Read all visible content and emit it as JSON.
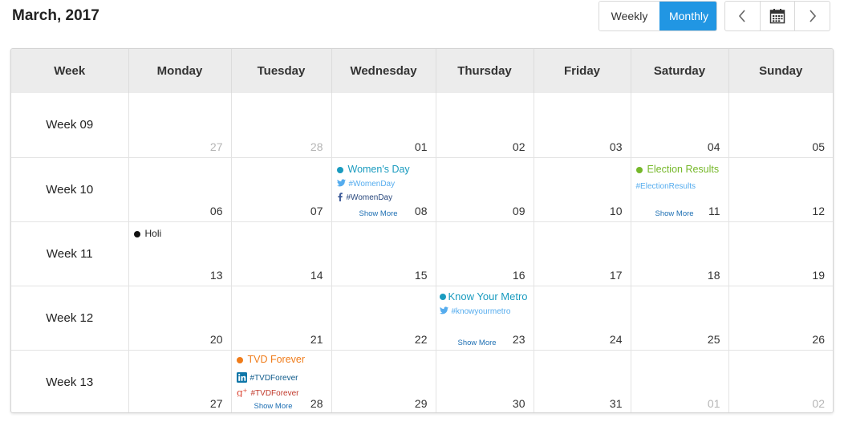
{
  "header": {
    "title": "March, 2017",
    "view_weekly": "Weekly",
    "view_monthly": "Monthly"
  },
  "colors": {
    "accent": "#2196e3",
    "teal": "#1a9bbf",
    "green": "#76b82a",
    "orange": "#f07c1a",
    "twitter": "#55acee",
    "facebook": "#3b5998",
    "linkedin": "#0e76a8",
    "googleplus": "#dd4b39"
  },
  "columns": [
    "Week",
    "Monday",
    "Tuesday",
    "Wednesday",
    "Thursday",
    "Friday",
    "Saturday",
    "Sunday"
  ],
  "weeks": [
    {
      "label": "Week 09",
      "days": [
        "27",
        "28",
        "01",
        "02",
        "03",
        "04",
        "05"
      ]
    },
    {
      "label": "Week 10",
      "days": [
        "06",
        "07",
        "08",
        "09",
        "10",
        "11",
        "12"
      ]
    },
    {
      "label": "Week 11",
      "days": [
        "13",
        "14",
        "15",
        "16",
        "17",
        "18",
        "19"
      ]
    },
    {
      "label": "Week 12",
      "days": [
        "20",
        "21",
        "22",
        "23",
        "24",
        "25",
        "26"
      ]
    },
    {
      "label": "Week 13",
      "days": [
        "27",
        "28",
        "29",
        "30",
        "31",
        "01",
        "02"
      ]
    }
  ],
  "events": {
    "womens_day": {
      "title": "Women's Day",
      "twitter_tag": "#WomenDay",
      "facebook_tag": "#WomenDay",
      "show_more": "Show More"
    },
    "election": {
      "title": "Election Results",
      "twitter_tag": "#ElectionResults",
      "show_more": "Show More"
    },
    "holi": {
      "title": "Holi"
    },
    "metro": {
      "title": "Know Your Metro",
      "twitter_tag": "#knowyourmetro",
      "show_more": "Show More"
    },
    "tvd": {
      "title": "TVD Forever",
      "linkedin_tag": "#TVDForever",
      "googleplus_tag": "#TVDForever",
      "show_more": "Show More"
    }
  }
}
